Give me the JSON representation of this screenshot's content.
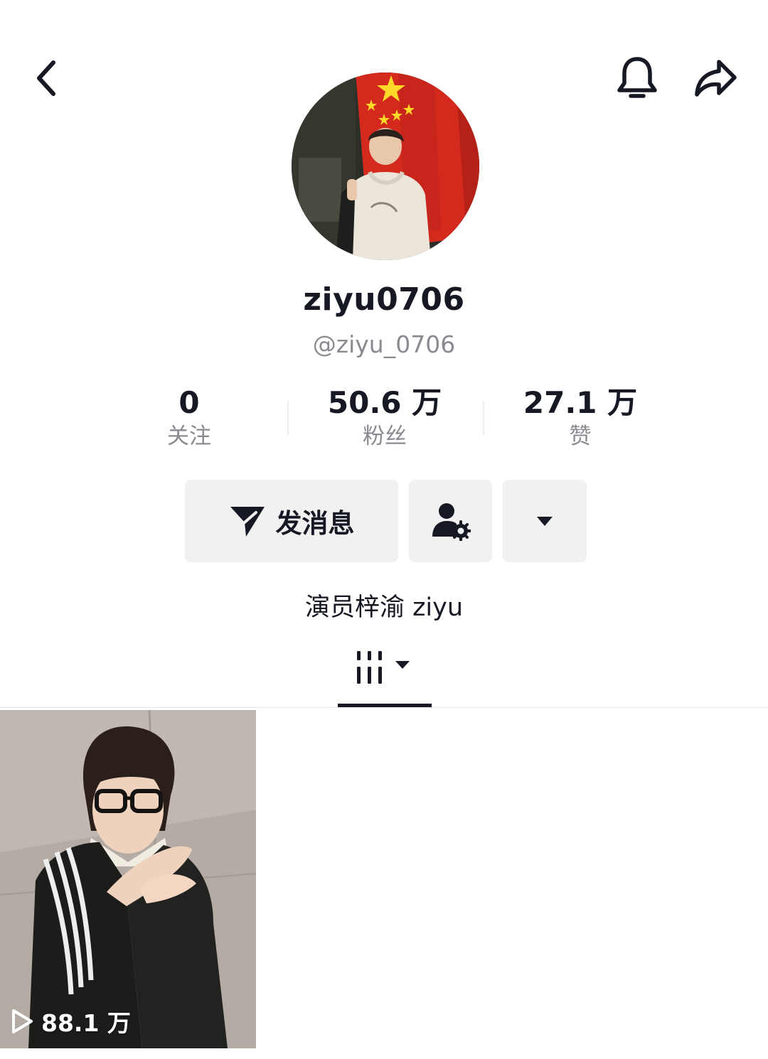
{
  "header": {
    "back_icon": "chevron-left-icon",
    "bell_icon": "bell-icon",
    "share_icon": "share-arrow-icon"
  },
  "profile": {
    "nickname": "ziyu0706",
    "handle": "@ziyu_0706",
    "bio": "演员梓渝 ziyu"
  },
  "stats": [
    {
      "value": "0",
      "label": "关注"
    },
    {
      "value": "50.6 万",
      "label": "粉丝"
    },
    {
      "value": "27.1 万",
      "label": "赞"
    }
  ],
  "actions": {
    "message_label": "发消息",
    "message_icon": "send-icon",
    "follow_icon": "user-settings-icon",
    "more_icon": "caret-down-icon"
  },
  "tabs": {
    "active_icon": "grid-columns-icon"
  },
  "videos": [
    {
      "play_count": "88.1 万"
    }
  ],
  "colors": {
    "text_primary": "#161823",
    "text_secondary": "#8a8b91",
    "button_bg": "#f1f1f2",
    "flag_red": "#d42a1e"
  }
}
